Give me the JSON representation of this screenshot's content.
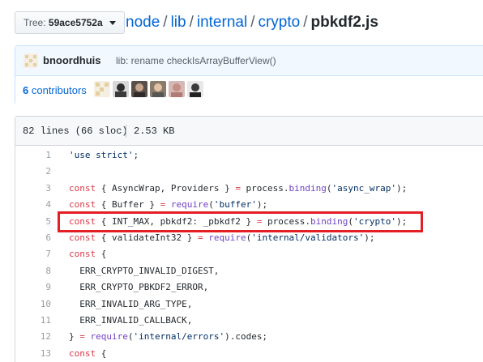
{
  "header": {
    "tree_label": "Tree:",
    "tree_value": "59ace5752a",
    "breadcrumb": [
      "node",
      "lib",
      "internal",
      "crypto"
    ],
    "separator": "/",
    "filename": "pbkdf2.js"
  },
  "commit": {
    "author": "bnoordhuis",
    "message": "lib: rename checkIsArrayBufferView()"
  },
  "contributors": {
    "count": "6",
    "label": "contributors",
    "avatar_colors": [
      "#e8d9b8",
      "#3b3b3b",
      "#5a4a4a",
      "#7b6a5a",
      "#c99",
      "#444"
    ]
  },
  "file": {
    "lines_info": "82 lines (66 sloc)",
    "size": "2.53 KB"
  },
  "code_lines": [
    {
      "n": "1",
      "tokens": [
        [
          "st",
          "'use strict'"
        ],
        [
          "",
          ";"
        ]
      ]
    },
    {
      "n": "2",
      "tokens": []
    },
    {
      "n": "3",
      "tokens": [
        [
          "kw",
          "const"
        ],
        [
          "",
          " { AsyncWrap, Providers } "
        ],
        [
          "kw",
          "="
        ],
        [
          "",
          " process."
        ],
        [
          "fn",
          "binding"
        ],
        [
          "",
          "("
        ],
        [
          "st",
          "'async_wrap'"
        ],
        [
          "",
          ");"
        ]
      ]
    },
    {
      "n": "4",
      "tokens": [
        [
          "kw",
          "const"
        ],
        [
          "",
          " { Buffer } "
        ],
        [
          "kw",
          "="
        ],
        [
          "",
          " "
        ],
        [
          "fn",
          "require"
        ],
        [
          "",
          "("
        ],
        [
          "st",
          "'buffer'"
        ],
        [
          "",
          ");"
        ]
      ]
    },
    {
      "n": "5",
      "tokens": [
        [
          "kw",
          "const"
        ],
        [
          "",
          " { INT_MAX, pbkdf2: _pbkdf2 } "
        ],
        [
          "kw",
          "="
        ],
        [
          "",
          " process."
        ],
        [
          "fn",
          "binding"
        ],
        [
          "",
          "("
        ],
        [
          "st",
          "'crypto'"
        ],
        [
          "",
          ");"
        ]
      ]
    },
    {
      "n": "6",
      "tokens": [
        [
          "kw",
          "const"
        ],
        [
          "",
          " { validateInt32 } "
        ],
        [
          "kw",
          "="
        ],
        [
          "",
          " "
        ],
        [
          "fn",
          "require"
        ],
        [
          "",
          "("
        ],
        [
          "st",
          "'internal/validators'"
        ],
        [
          "",
          ");"
        ]
      ]
    },
    {
      "n": "7",
      "tokens": [
        [
          "kw",
          "const"
        ],
        [
          "",
          " {"
        ]
      ]
    },
    {
      "n": "8",
      "tokens": [
        [
          "",
          "  ERR_CRYPTO_INVALID_DIGEST,"
        ]
      ]
    },
    {
      "n": "9",
      "tokens": [
        [
          "",
          "  ERR_CRYPTO_PBKDF2_ERROR,"
        ]
      ]
    },
    {
      "n": "10",
      "tokens": [
        [
          "",
          "  ERR_INVALID_ARG_TYPE,"
        ]
      ]
    },
    {
      "n": "11",
      "tokens": [
        [
          "",
          "  ERR_INVALID_CALLBACK,"
        ]
      ]
    },
    {
      "n": "12",
      "tokens": [
        [
          "",
          "} "
        ],
        [
          "kw",
          "="
        ],
        [
          "",
          " "
        ],
        [
          "fn",
          "require"
        ],
        [
          "",
          "("
        ],
        [
          "st",
          "'internal/errors'"
        ],
        [
          "",
          ").codes;"
        ]
      ]
    },
    {
      "n": "13",
      "tokens": [
        [
          "kw",
          "const"
        ],
        [
          "",
          " {"
        ]
      ]
    }
  ],
  "highlight_line": "5"
}
